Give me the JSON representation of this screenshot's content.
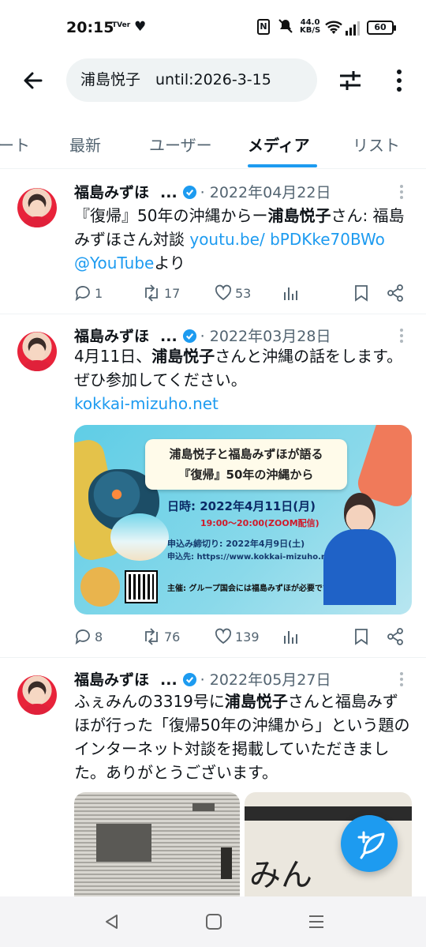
{
  "status_bar": {
    "time": "20:15",
    "tv_label": "TVer",
    "speed_top": "44.0",
    "speed_bottom": "KB/S",
    "battery": "60",
    "nfc": "N"
  },
  "search": {
    "query": "浦島悦子　until:2026-3-15"
  },
  "tabs": [
    {
      "label": "ート",
      "active": false
    },
    {
      "label": "最新",
      "active": false
    },
    {
      "label": "ユーザー",
      "active": false
    },
    {
      "label": "メディア",
      "active": true
    },
    {
      "label": "リスト",
      "active": false
    }
  ],
  "tweets": [
    {
      "name": "福島みずほ",
      "dots": "...",
      "date": "· 2022年04月22日",
      "text_parts": [
        "『復帰』50年の沖縄からー",
        "浦島悦子",
        "さん: 福島みずほさん対談 ",
        "youtu.be/ bPDKke70BWo",
        " ",
        "@YouTube",
        "より"
      ],
      "replies": "1",
      "retweets": "17",
      "likes": "53"
    },
    {
      "name": "福島みずほ",
      "dots": "...",
      "date": "· 2022年03月28日",
      "text_parts": [
        "4月11日、",
        "浦島悦子",
        "さんと沖縄の話をします。ぜひ参加してください。"
      ],
      "link": "kokkai-mizuho.net",
      "card": {
        "banner_line1": "浦島悦子と福島みずほが語る",
        "banner_line2": "『復帰』50年の沖縄から",
        "date_line": "日時: 2022年4月11日(月)",
        "time_line": "19:00〜20:00(ZOOM配信)",
        "deadline": "申込み締切り: 2022年4月9日(土)",
        "apply": "申込先: https://www.kokkai-mizuho.net/",
        "organizer": "主催: グループ国会には福島みずほが必要です"
      },
      "replies": "8",
      "retweets": "76",
      "likes": "139"
    },
    {
      "name": "福島みずほ",
      "dots": "...",
      "date": "· 2022年05月27日",
      "text_parts": [
        "ふぇみんの3319号に",
        "浦島悦子",
        "さんと福島みずほが行った「復帰50年の沖縄から」という題のインターネット対談を掲載していただきました。ありがとうございます。"
      ],
      "photo2_text": "みん"
    }
  ],
  "colors": {
    "accent": "#1d9bf0",
    "text": "#0f1419",
    "muted": "#536471"
  }
}
